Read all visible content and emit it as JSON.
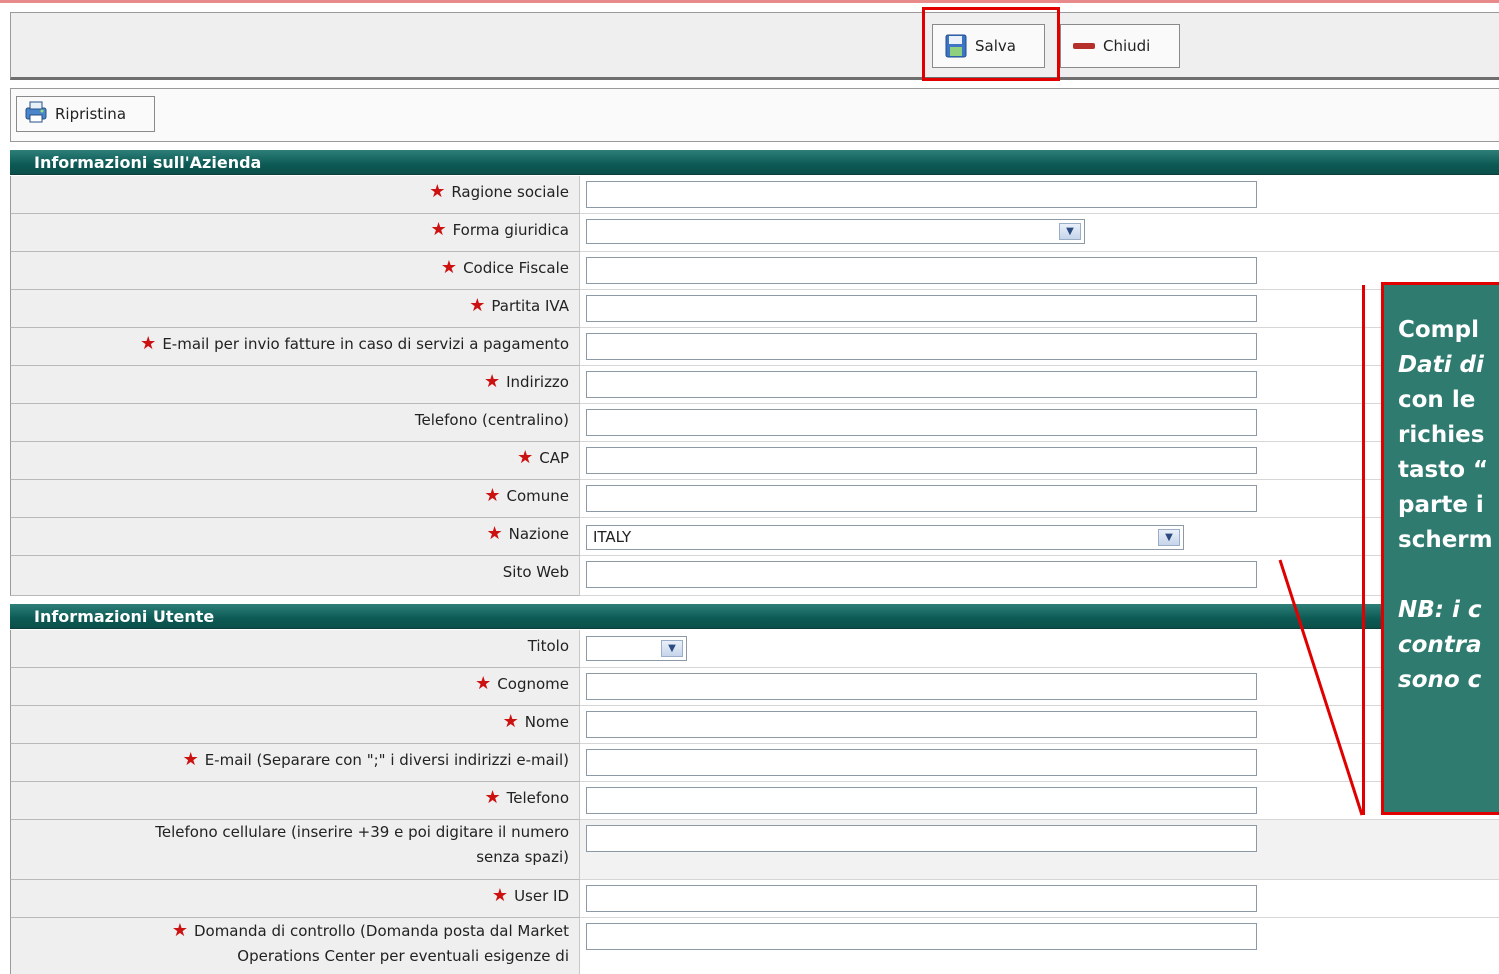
{
  "toolbar": {
    "save_label": "Salva",
    "close_label": "Chiudi"
  },
  "subbar": {
    "restore_label": "Ripristina"
  },
  "company_section": {
    "title": "Informazioni sull'Azienda",
    "fields": {
      "ragione_sociale": "Ragione sociale",
      "forma_giuridica": "Forma giuridica",
      "codice_fiscale": "Codice Fiscale",
      "partita_iva": "Partita IVA",
      "email_fatture": "E-mail per invio fatture in caso di servizi a pagamento",
      "indirizzo": "Indirizzo",
      "telefono_centralino": "Telefono (centralino)",
      "cap": "CAP",
      "comune": "Comune",
      "nazione": "Nazione",
      "nazione_value": "ITALY",
      "sito_web": "Sito Web"
    }
  },
  "user_section": {
    "title": "Informazioni Utente",
    "fields": {
      "titolo": "Titolo",
      "cognome": "Cognome",
      "nome": "Nome",
      "email": "E-mail (Separare con \";\" i diversi indirizzi e-mail)",
      "telefono": "Telefono",
      "cellulare_1": "Telefono cellulare (inserire +39 e poi digitare il numero",
      "cellulare_2": "senza spazi)",
      "user_id": "User ID",
      "domanda_1": "Domanda di controllo (Domanda posta dal Market",
      "domanda_2": "Operations Center per eventuali esigenze di"
    }
  },
  "required_marker": "★",
  "annotation": {
    "line1": "Compl",
    "line2": "Dati di",
    "line3": "con le",
    "line4": "richies",
    "line5": "tasto “",
    "line6": "parte i",
    "line7": "scherm",
    "line8": "NB: i c",
    "line9": "contra",
    "line10": "sono c"
  },
  "colors": {
    "header_teal": "#0d5a55",
    "annotation_bg": "#2f7b70",
    "highlight_red": "#e00000"
  },
  "icons": {
    "save": "floppy-disk-icon",
    "close": "minus-icon",
    "restore": "printer-restore-icon",
    "dropdown": "chevron-down-icon",
    "required": "asterisk-icon"
  }
}
